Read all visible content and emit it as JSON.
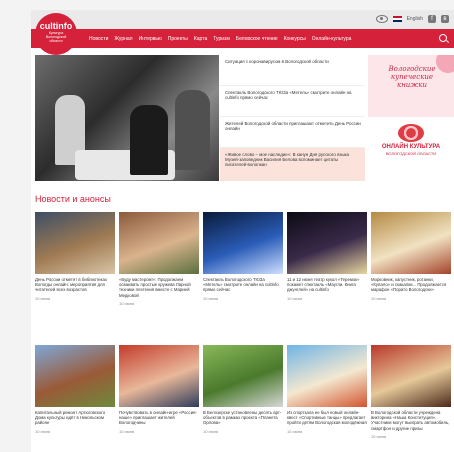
{
  "header": {
    "logo_brand": "cultinfo",
    "logo_tagline": "Культура Вологодской области",
    "lang_label": "English",
    "nav_items": [
      "Новости",
      "Журнал",
      "Интервью",
      "Проекты",
      "Карта",
      "Туризм",
      "Беловское чтение",
      "Конкурсы",
      "Онлайн-культура"
    ]
  },
  "hero": {
    "news": [
      "Ситуация с коронавирусом в Вологодской области",
      "Спектакль Вологодского ТЮЗа «Метель» смотрите онлайн на cultinfo прямо сейчас",
      "Жителей Вологодской области приглашают отметить День России онлайн",
      "«Живое слово – мое наследие»: В канун Дня русского языка Музей-заповедник Василия Белова вспоминает цитаты писателей-вологжан"
    ],
    "banner1_text": "Вологодские купеческие книжки",
    "banner2_title": "ОНЛАЙН КУЛЬТУРА",
    "banner2_sub": "ВОЛОГОДСКОЙ ОБЛАСТИ"
  },
  "section": {
    "title": "Новости и анонсы"
  },
  "cards": [
    {
      "caption": "День России отметят в библиотеках Вологды онлайн: мероприятия для читателей всех возрастов",
      "date": "10 июня",
      "colors": [
        "#3d4e66",
        "#a07b53",
        "#d8c5a8"
      ]
    },
    {
      "caption": "«Буду мастером!»: Продолжаем осваивать простые кружева Ларной техники плетения вместе с Марией Медковой",
      "date": "10 июня",
      "colors": [
        "#8b5a3c",
        "#d9b38c",
        "#5a7040"
      ]
    },
    {
      "caption": "Спектакль Вологодского ТЮЗа «Метель» смотрите онлайн на cultinfo прямо сейчас",
      "date": "10 июня",
      "colors": [
        "#0a1b3a",
        "#2a5cb8",
        "#cfe0ff"
      ]
    },
    {
      "caption": "11 и 12 июня театр кукол «Теремок» покажет спектакль «Маугли. Книга джунглей» на cultinfo",
      "date": "10 июня",
      "colors": [
        "#0b0b14",
        "#3a2a4a",
        "#e8d6a0"
      ]
    },
    {
      "caption": "Морковник, капустник, ротанки, «Купало» и скакалки... Продолжается марафон «Порато Вологодски»",
      "date": "10 июня",
      "colors": [
        "#b58a44",
        "#f1e2c2",
        "#a3442b"
      ]
    },
    {
      "caption": "Капитальный ремонт Артюговского Дома культуры идёт в Никольском районе",
      "date": "10 июня",
      "colors": [
        "#7fa7d8",
        "#9a5a38",
        "#6e8a3c"
      ]
    },
    {
      "caption": "Почувствовать в онлайн-игре «Россия-наше» приглашает жителей Вологодчины",
      "date": "10 июня",
      "colors": [
        "#c43c2c",
        "#e8b89a",
        "#2e3c5a"
      ]
    },
    {
      "caption": "В Белозерске установлены десять арт-объектов в рамках проекта «Планета Орлова»",
      "date": "10 июня",
      "colors": [
        "#8ab85a",
        "#4a7a2c",
        "#d8d8d8"
      ]
    },
    {
      "caption": "Из спортзала не был новый онлайн-квест «Спортивные танцы» предлагает пройти детям Вологодская молодёжная",
      "date": "10 июня",
      "colors": [
        "#6fb4e6",
        "#f4e8d0",
        "#d2552f"
      ]
    },
    {
      "caption": "В Вологодской области учреждена викторина «Наша Конституция». Участники могут выиграть автомобиль, смартфон и другие призы",
      "date": "10 июня",
      "colors": [
        "#b8382a",
        "#e6c89a",
        "#4a2a1a"
      ]
    }
  ]
}
